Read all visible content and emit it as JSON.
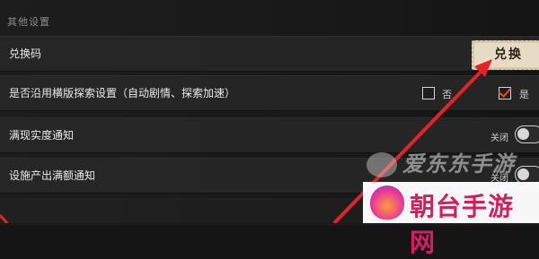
{
  "section_title": "其他设置",
  "rows": {
    "redeem": {
      "label": "兑换码",
      "button": "兑换"
    },
    "follow_mode": {
      "label": "是否沿用横版探索设置（自动剧情、探索加速）",
      "option_no": "否",
      "option_yes": "是",
      "selected": "是"
    },
    "realtime_notify": {
      "label": "满现实度通知",
      "state": "关闭"
    },
    "facility_notify": {
      "label": "设施产出满额通知",
      "state": "关闭"
    }
  },
  "watermark": {
    "top": "爱东东手游",
    "bottom": "朝台手游网"
  },
  "colors": {
    "accent_check": "#e0531f",
    "arrow": "#e3222a",
    "button_bg": "#e7dcc3"
  }
}
